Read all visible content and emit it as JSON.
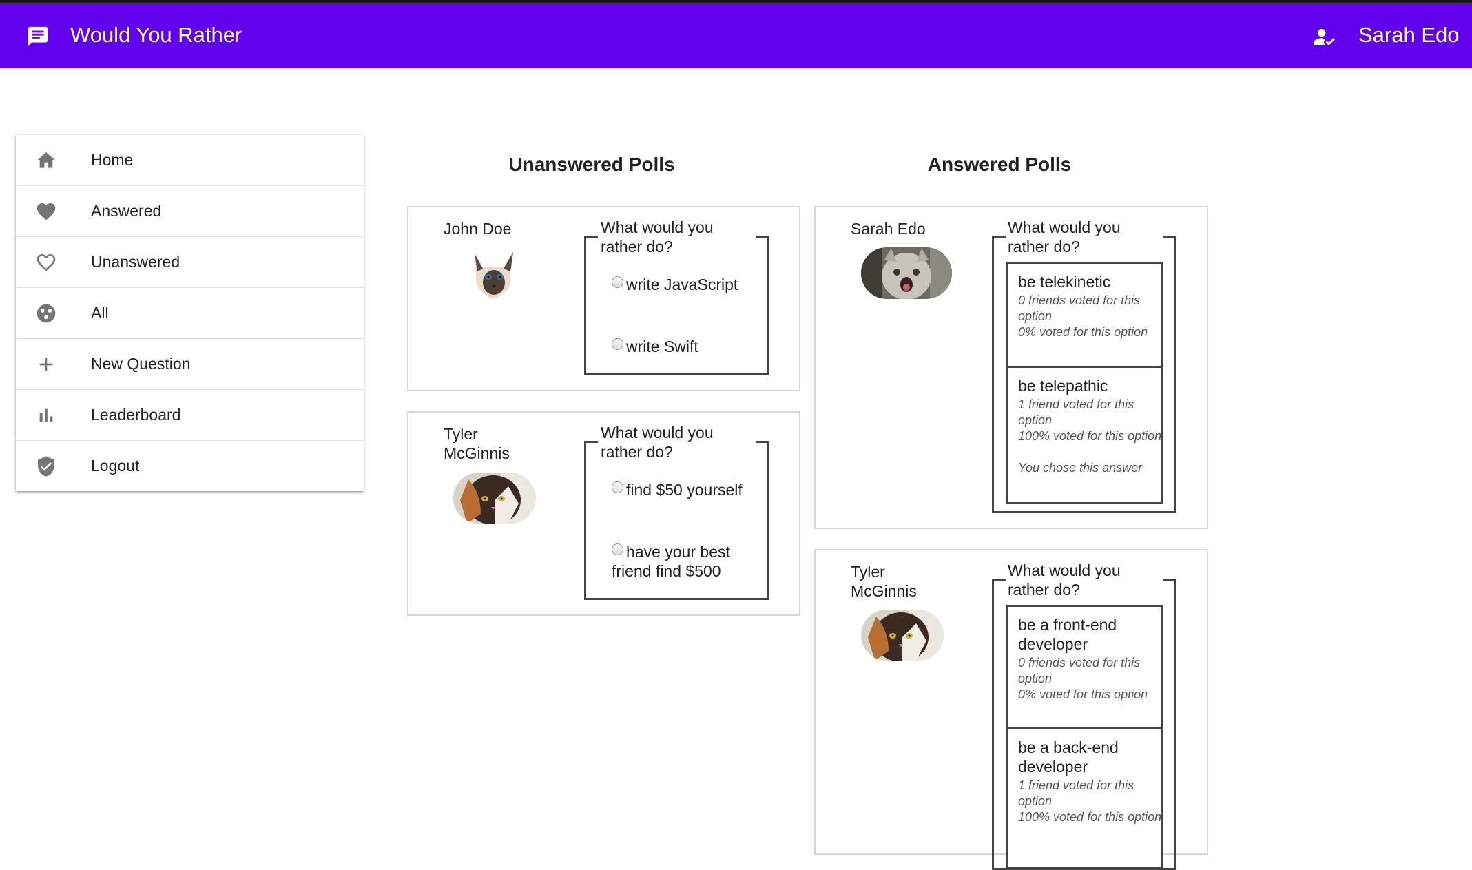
{
  "appbar": {
    "title": "Would You Rather",
    "user_name": "Sarah Edo"
  },
  "sidebar": {
    "items": [
      {
        "label": "Home",
        "icon": "home-icon"
      },
      {
        "label": "Answered",
        "icon": "heart-filled-icon"
      },
      {
        "label": "Unanswered",
        "icon": "heart-outline-icon"
      },
      {
        "label": "All",
        "icon": "all-circles-icon"
      },
      {
        "label": "New Question",
        "icon": "plus-icon"
      },
      {
        "label": "Leaderboard",
        "icon": "bar-chart-icon"
      },
      {
        "label": "Logout",
        "icon": "shield-check-icon"
      }
    ]
  },
  "columns": {
    "unanswered_title": "Unanswered Polls",
    "answered_title": "Answered Polls"
  },
  "unanswered": [
    {
      "author": "John Doe",
      "question": "What would you rather do?",
      "options": [
        "write JavaScript",
        "write Swift"
      ]
    },
    {
      "author": "Tyler McGinnis",
      "question": "What would you rather do?",
      "options": [
        "find $50 yourself",
        "have your best friend find $500"
      ]
    }
  ],
  "answered": [
    {
      "author": "Sarah Edo",
      "question": "What would you rather do?",
      "options": [
        {
          "text": "be telekinetic",
          "votes": "0 friends voted for this option",
          "percent": "0% voted for this option",
          "chosen": ""
        },
        {
          "text": "be telepathic",
          "votes": "1 friend voted for this option",
          "percent": "100% voted for this option",
          "chosen": "You chose this answer"
        }
      ]
    },
    {
      "author": "Tyler McGinnis",
      "question": "What would you rather do?",
      "options": [
        {
          "text": "be a front-end developer",
          "votes": "0 friends voted for this option",
          "percent": "0% voted for this option"
        },
        {
          "text": "be a back-end developer",
          "votes": "1 friend voted for this option",
          "percent": "100% voted for this option"
        }
      ]
    }
  ],
  "colors": {
    "appbar": "#6200ee",
    "icon_gray": "#757575",
    "border": "#444444"
  }
}
